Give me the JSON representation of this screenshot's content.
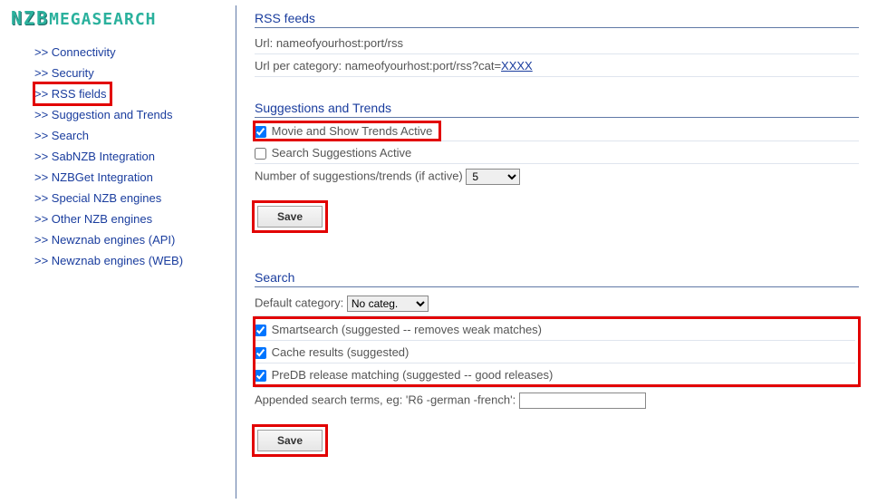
{
  "logo": {
    "part1": "NZB",
    "part2": "MEGASEARCH"
  },
  "nav": {
    "connectivity": ">> Connectivity",
    "security": ">> Security",
    "rss_fields": ">> RSS fields",
    "suggestion_trends": ">> Suggestion and Trends",
    "search": ">> Search",
    "sabnzb": ">> SabNZB Integration",
    "nzbget": ">> NZBGet Integration",
    "special": ">> Special NZB engines",
    "other": ">> Other NZB engines",
    "newznab_api": ">> Newznab engines (API)",
    "newznab_web": ">> Newznab engines (WEB)"
  },
  "rss": {
    "title": "RSS feeds",
    "url_label": "Url: nameofyourhost:port/rss",
    "url_cat_prefix": "Url per category: nameofyourhost:port/rss?cat=",
    "url_cat_link": "XXXX"
  },
  "suggestions": {
    "title": "Suggestions and Trends",
    "movie_trends": "Movie and Show Trends Active",
    "search_suggestions": "Search Suggestions Active",
    "num_label": "Number of suggestions/trends (if active) ",
    "num_value": "5",
    "save": "Save"
  },
  "search": {
    "title": "Search",
    "default_cat_label": "Default category: ",
    "default_cat_value": "No categ.",
    "smartsearch": "Smartsearch (suggested -- removes weak matches)",
    "cache": "Cache results (suggested)",
    "predb": "PreDB release matching (suggested -- good releases)",
    "appended_label": "Appended search terms, eg: 'R6 -german -french': ",
    "save": "Save"
  }
}
